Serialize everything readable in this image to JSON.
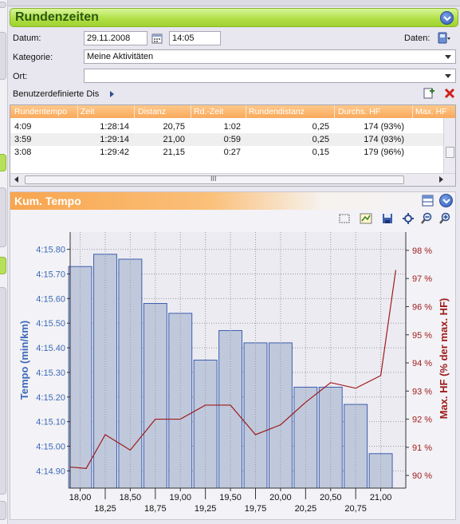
{
  "header": {
    "title": "Rundenzeiten"
  },
  "form": {
    "datum_label": "Datum:",
    "datum_value": "29.11.2008",
    "time_value": "14:05",
    "daten_label": "Daten:",
    "kategorie_label": "Kategorie:",
    "kategorie_value": "Meine Aktivitäten",
    "ort_label": "Ort:",
    "ort_value": "",
    "custom_label": "Benutzerdefinierte Dis"
  },
  "table": {
    "columns": [
      "Rundentempo",
      "Zeit",
      "Distanz",
      "Rd.-Zeit",
      "Rundendistanz",
      "Durchs. HF",
      "Max. HF"
    ],
    "rows": [
      [
        "4:09",
        "1:28:14",
        "20,75",
        "1:02",
        "0,25",
        "174 (93%)",
        ""
      ],
      [
        "3:59",
        "1:29:14",
        "21,00",
        "0:59",
        "0,25",
        "174 (93%)",
        ""
      ],
      [
        "3:08",
        "1:29:42",
        "21,15",
        "0:27",
        "0,15",
        "179 (96%)",
        ""
      ]
    ],
    "hscroll_grip": "III"
  },
  "chart_panel": {
    "title": "Kum. Tempo"
  },
  "chart_data": {
    "type": "bar",
    "xlabel": "",
    "ylabel": "Tempo (min/km)",
    "y2label": "Max. HF (% der max. HF)",
    "x_tick_labels_top": [
      "18,00",
      "18,50",
      "19,00",
      "19,50",
      "20,00",
      "20,50",
      "21,00"
    ],
    "x_tick_labels_bottom": [
      "18,25",
      "18,75",
      "19,25",
      "19,75",
      "20,25",
      "20,75"
    ],
    "y_tick_labels": [
      "4:14.90",
      "4:15.00",
      "4:15.10",
      "4:15.20",
      "4:15.30",
      "4:15.40",
      "4:15.50",
      "4:15.60",
      "4:15.70",
      "4:15.80"
    ],
    "y_ticks": [
      4.9,
      5.0,
      5.1,
      5.2,
      5.3,
      5.4,
      5.5,
      5.6,
      5.7,
      5.8
    ],
    "ylim": [
      4.83,
      5.87
    ],
    "y2_tick_labels": [
      "90 %",
      "91 %",
      "92 %",
      "93 %",
      "94 %",
      "95 %",
      "96 %",
      "97 %",
      "98 %"
    ],
    "y2_ticks": [
      90,
      91,
      92,
      93,
      94,
      95,
      96,
      97,
      98
    ],
    "y2lim": [
      89.55,
      98.65
    ],
    "xlim": [
      17.9,
      21.25
    ],
    "bars": {
      "name": "Tempo",
      "color": "#c0c8dc",
      "edge": "#3b5fae",
      "x": [
        18.0,
        18.25,
        18.5,
        18.75,
        19.0,
        19.25,
        19.5,
        19.75,
        20.0,
        20.25,
        20.5,
        20.75,
        21.0
      ],
      "values": [
        5.73,
        5.78,
        5.76,
        5.58,
        5.54,
        5.35,
        5.47,
        5.42,
        5.42,
        5.24,
        5.24,
        5.17,
        4.97
      ],
      "width": 0.23
    },
    "line": {
      "name": "Max. HF",
      "color": "#9e1b1b",
      "x": [
        17.9,
        18.06,
        18.25,
        18.5,
        18.75,
        19.0,
        19.25,
        19.5,
        19.75,
        20.0,
        20.25,
        20.5,
        20.75,
        21.0,
        21.15
      ],
      "values": [
        90.3,
        90.25,
        91.45,
        90.9,
        92.0,
        92.0,
        92.5,
        92.5,
        91.45,
        91.8,
        92.6,
        93.3,
        93.1,
        93.55,
        97.3
      ]
    },
    "grid": true,
    "left_axis_color": "#3b6ab8",
    "right_axis_color": "#9e1b1b"
  }
}
